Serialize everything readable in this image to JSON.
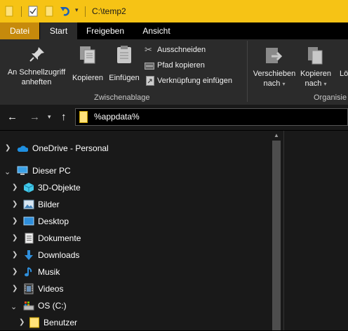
{
  "window": {
    "title": "C:\\temp2"
  },
  "tabs": {
    "file": "Datei",
    "start": "Start",
    "share": "Freigeben",
    "view": "Ansicht"
  },
  "ribbon": {
    "pin_line1": "An Schnellzugriff",
    "pin_line2": "anheften",
    "copy": "Kopieren",
    "paste": "Einfügen",
    "cut": "Ausschneiden",
    "copy_path": "Pfad kopieren",
    "paste_shortcut": "Verknüpfung einfügen",
    "group_clipboard": "Zwischenablage",
    "move_line1": "Verschieben",
    "move_line2": "nach",
    "copyto_line1": "Kopieren",
    "copyto_line2": "nach",
    "group_organize": "Organisie",
    "delete_partial": "Lö"
  },
  "address": {
    "value": "%appdata%"
  },
  "tree": {
    "items": [
      {
        "label": "OneDrive - Personal",
        "icon": "onedrive-cloud-icon",
        "chevron": "right"
      },
      {
        "label": "Dieser PC",
        "icon": "this-pc-icon",
        "chevron": "down"
      },
      {
        "label": "3D-Objekte",
        "icon": "3d-objects-icon",
        "chevron": "right"
      },
      {
        "label": "Bilder",
        "icon": "pictures-icon",
        "chevron": "right"
      },
      {
        "label": "Desktop",
        "icon": "desktop-icon",
        "chevron": "right"
      },
      {
        "label": "Dokumente",
        "icon": "documents-icon",
        "chevron": "right"
      },
      {
        "label": "Downloads",
        "icon": "downloads-icon",
        "chevron": "right"
      },
      {
        "label": "Musik",
        "icon": "music-icon",
        "chevron": "right"
      },
      {
        "label": "Videos",
        "icon": "videos-icon",
        "chevron": "right"
      },
      {
        "label": "OS (C:)",
        "icon": "drive-c-icon",
        "chevron": "down"
      },
      {
        "label": "Benutzer",
        "icon": "folder-icon",
        "chevron": "right"
      }
    ]
  },
  "colors": {
    "titlebar": "#f6c315",
    "file_tab": "#c68a0c",
    "ribbon": "#2b2b2b",
    "pane": "#191919"
  }
}
